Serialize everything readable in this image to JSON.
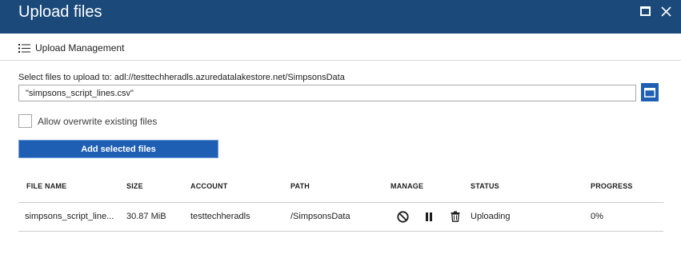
{
  "window": {
    "title": "Upload files",
    "maximize_icon": "maximize-icon",
    "close_icon": "close-icon",
    "titlebar_color": "#1b4a7a"
  },
  "toolbar": {
    "upload_management_icon": "list-icon",
    "upload_management_label": "Upload Management"
  },
  "form": {
    "select_label": "Select files to upload to: adl://testtechheradls.azuredatalakestore.net/SimpsonsData",
    "file_value": "\"simpsons_script_lines.csv\"",
    "browse_icon": "folder-browse-icon",
    "overwrite_label": "Allow overwrite existing files",
    "overwrite_checked": false,
    "add_button_label": "Add selected files",
    "accent_color": "#1e5fb4"
  },
  "table": {
    "headers": [
      "FILE NAME",
      "SIZE",
      "ACCOUNT",
      "PATH",
      "MANAGE",
      "STATUS",
      "PROGRESS"
    ],
    "rows": [
      {
        "file_name": "simpsons_script_line...",
        "size": "30.87 MiB",
        "account": "testtechheradls",
        "path": "/SimpsonsData",
        "manage_icons": [
          "cancel-icon",
          "pause-icon",
          "trash-icon"
        ],
        "status": "Uploading",
        "progress": "0%"
      }
    ]
  }
}
